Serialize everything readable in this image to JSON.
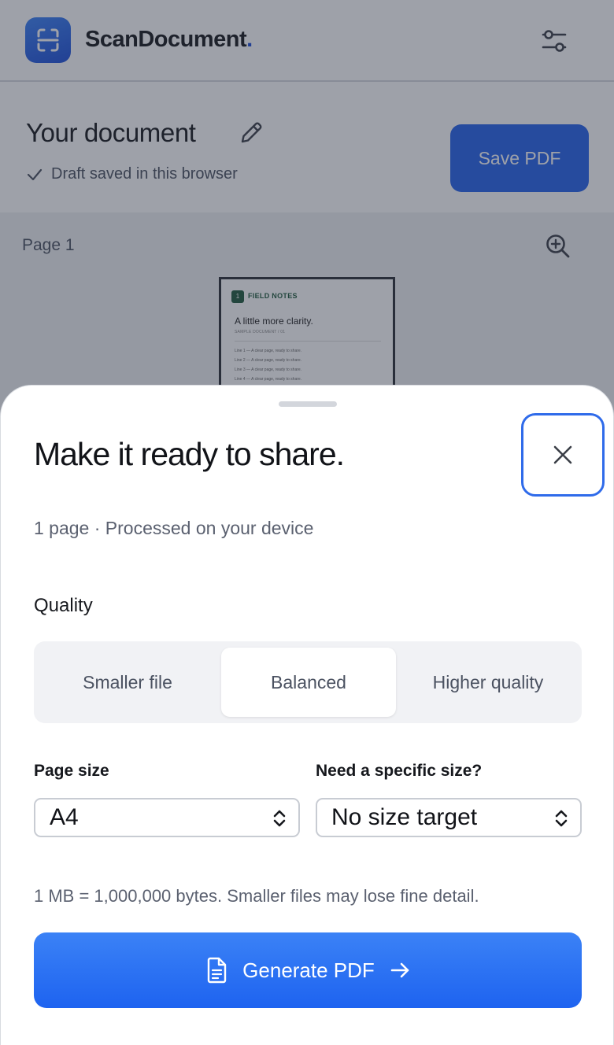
{
  "app": {
    "brand_name": "ScanDocument",
    "brand_dot": ".",
    "accent_color": "#2563eb"
  },
  "header": {
    "doc_title": "Your document",
    "draft_status": "Draft saved in this browser",
    "save_label": "Save PDF"
  },
  "preview": {
    "page_label": "Page 1",
    "thumbnail": {
      "badge": "1",
      "section": "FIELD NOTES",
      "headline": "A little more clarity.",
      "sample": "SAMPLE DOCUMENT / 01",
      "lines": [
        "Line 1 — A clear page, ready to share.",
        "Line 2 — A clear page, ready to share.",
        "Line 3 — A clear page, ready to share.",
        "Line 4 — A clear page, ready to share."
      ]
    }
  },
  "sheet": {
    "title": "Make it ready to share.",
    "subtitle": "1 page · Processed on your device",
    "quality_label": "Quality",
    "quality_options": [
      "Smaller file",
      "Balanced",
      "Higher quality"
    ],
    "quality_selected": "Balanced",
    "page_size_label": "Page size",
    "page_size_value": "A4",
    "target_label": "Need a specific size?",
    "target_value": "No size target",
    "hint": "1 MB = 1,000,000 bytes. Smaller files may lose fine detail.",
    "generate_label": "Generate PDF"
  }
}
